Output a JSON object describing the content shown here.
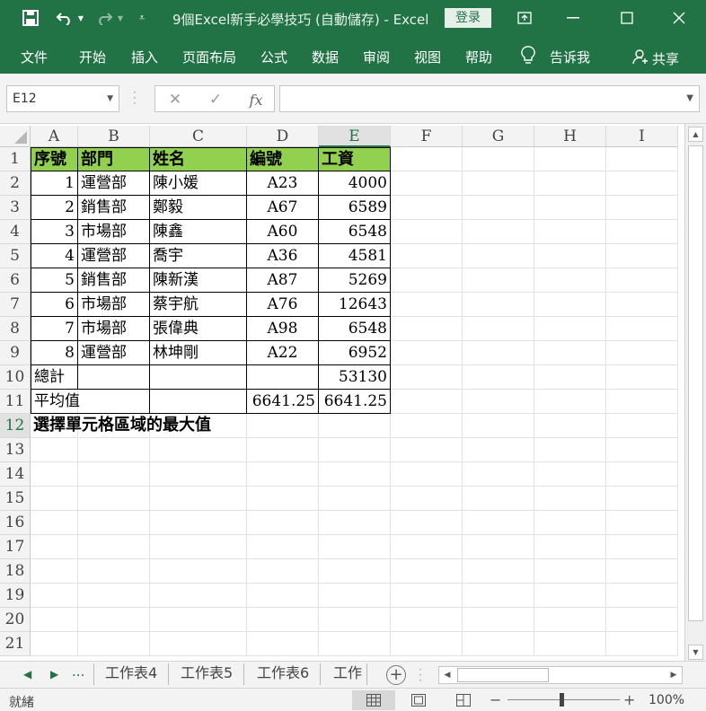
{
  "titlebar": {
    "title": "9個Excel新手必學技巧 (自動儲存)  -  Excel",
    "login": "登录"
  },
  "ribbon": {
    "tabs": [
      "文件",
      "开始",
      "插入",
      "页面布局",
      "公式",
      "数据",
      "审阅",
      "视图",
      "帮助"
    ],
    "tell_me": "告诉我",
    "share": "共享"
  },
  "formula_bar": {
    "name_box": "E12",
    "fx_label": "fx",
    "content": ""
  },
  "grid": {
    "columns": [
      "A",
      "B",
      "C",
      "D",
      "E",
      "F",
      "G",
      "H",
      "I"
    ],
    "rows": [
      "1",
      "2",
      "3",
      "4",
      "5",
      "6",
      "7",
      "8",
      "9",
      "10",
      "11",
      "12",
      "13",
      "14",
      "15",
      "16",
      "17",
      "18",
      "19",
      "20",
      "21"
    ],
    "header": [
      "序號",
      "部門",
      "姓名",
      "編號",
      "工資"
    ],
    "data": [
      [
        "1",
        "運營部",
        "陳小媛",
        "A23",
        "4000"
      ],
      [
        "2",
        "銷售部",
        "鄭毅",
        "A67",
        "6589"
      ],
      [
        "3",
        "市場部",
        "陳鑫",
        "A60",
        "6548"
      ],
      [
        "4",
        "運營部",
        "喬宇",
        "A36",
        "4581"
      ],
      [
        "5",
        "銷售部",
        "陳新漢",
        "A87",
        "5269"
      ],
      [
        "6",
        "市場部",
        "蔡宇航",
        "A76",
        "12643"
      ],
      [
        "7",
        "市場部",
        "張偉典",
        "A98",
        "6548"
      ],
      [
        "8",
        "運營部",
        "林坤剛",
        "A22",
        "6952"
      ]
    ],
    "total_label": "總計",
    "total_value": "53130",
    "avg_label": "平均值",
    "avg_d": "6641.25",
    "avg_e": "6641.25",
    "note": "選擇單元格區域的最大值"
  },
  "sheets": {
    "more": "...",
    "tabs": [
      "工作表4",
      "工作表5",
      "工作表6",
      "工作"
    ]
  },
  "status": {
    "ready": "就緒",
    "zoom": "100%"
  },
  "colors": {
    "excel_green": "#217346",
    "header_fill": "#92d050"
  }
}
